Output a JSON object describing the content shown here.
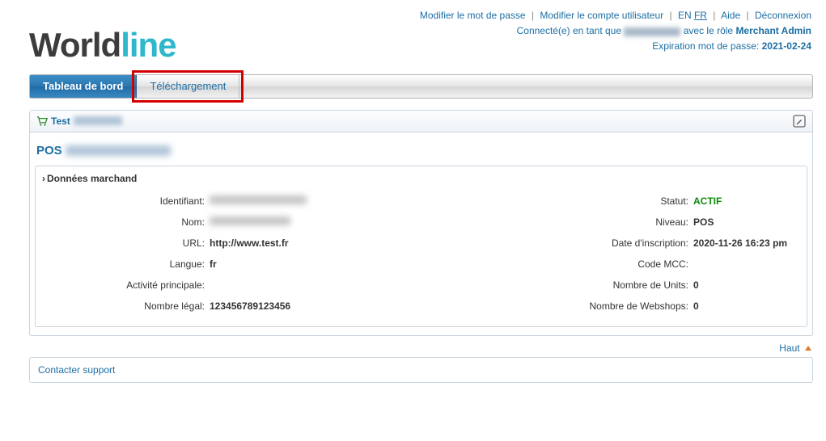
{
  "toplinks": {
    "change_pw": "Modifier le mot de passe",
    "change_user": "Modifier le compte utilisateur",
    "lang_en": "EN",
    "lang_fr": "FR",
    "help": "Aide",
    "logout": "Déconnexion",
    "connected_prefix": "Connecté(e) en tant que",
    "connected_suffix": "avec le rôle",
    "role": "Merchant Admin",
    "expiry_label": "Expiration mot de passe:",
    "expiry_value": "2021-02-24"
  },
  "logo": {
    "left": "World",
    "right": "line"
  },
  "tabs": {
    "dashboard": "Tableau de bord",
    "download": "Téléchargement"
  },
  "panel_header": {
    "title": "Test"
  },
  "pos_title": "POS",
  "section_title": "Données marchand",
  "fields": {
    "id_label": "Identifiant:",
    "name_label": "Nom:",
    "url_label": "URL:",
    "url_value": "http://www.test.fr",
    "lang_label": "Langue:",
    "lang_value": "fr",
    "activity_label": "Activité principale:",
    "activity_value": "",
    "legal_label": "Nombre légal:",
    "legal_value": "123456789123456",
    "status_label": "Statut:",
    "status_value": "ACTIF",
    "level_label": "Niveau:",
    "level_value": "POS",
    "reg_label": "Date d'inscription:",
    "reg_value": "2020-11-26 16:23 pm",
    "mcc_label": "Code MCC:",
    "mcc_value": "",
    "units_label": "Nombre de Units:",
    "units_value": "0",
    "webshops_label": "Nombre de Webshops:",
    "webshops_value": "0"
  },
  "haut": "Haut",
  "support": "Contacter support"
}
